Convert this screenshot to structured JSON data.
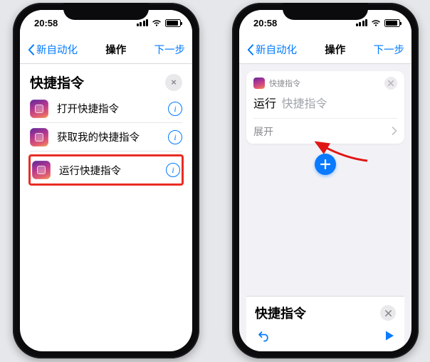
{
  "colors": {
    "accent": "#007aff",
    "highlight": "#ea2c24"
  },
  "status": {
    "time": "20:58"
  },
  "nav": {
    "back_label": "新自动化",
    "title": "操作",
    "next_label": "下一步"
  },
  "left": {
    "section_title": "快捷指令",
    "clear_icon_label": "×",
    "rows": [
      {
        "label": "打开快捷指令",
        "highlighted": false
      },
      {
        "label": "获取我的快捷指令",
        "highlighted": false
      },
      {
        "label": "运行快捷指令",
        "highlighted": true
      }
    ]
  },
  "right": {
    "card": {
      "app_label": "快捷指令",
      "run_label": "运行",
      "placeholder": "快捷指令",
      "expand_label": "展开"
    },
    "panel": {
      "title": "快捷指令"
    }
  }
}
